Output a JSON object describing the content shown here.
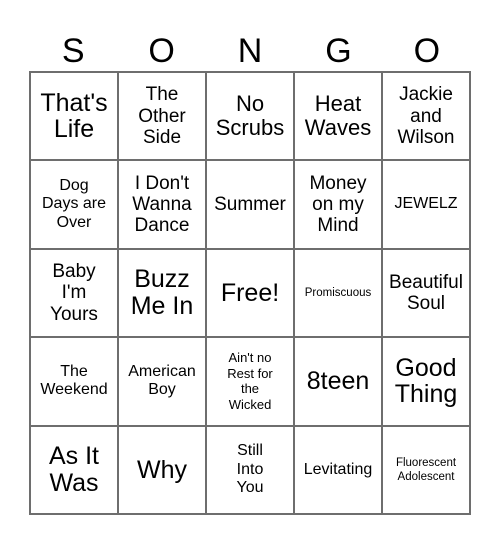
{
  "card": {
    "kind": "bingo-card",
    "header_letters": [
      "S",
      "O",
      "N",
      "G",
      "O"
    ],
    "grid_size": "5x5",
    "colors": {
      "background": "#ffffff",
      "text": "#000000",
      "grid_line": "#6e6e6e"
    },
    "rows": [
      [
        {
          "label": "That's\nLife",
          "size": "s-xl"
        },
        {
          "label": "The\nOther\nSide",
          "size": "s-md"
        },
        {
          "label": "No\nScrubs",
          "size": "s-lg"
        },
        {
          "label": "Heat\nWaves",
          "size": "s-lg"
        },
        {
          "label": "Jackie\nand\nWilson",
          "size": "s-md"
        }
      ],
      [
        {
          "label": "Dog\nDays are\nOver",
          "size": "s-sm"
        },
        {
          "label": "I Don't\nWanna\nDance",
          "size": "s-md"
        },
        {
          "label": "Summer",
          "size": "s-md"
        },
        {
          "label": "Money\non my\nMind",
          "size": "s-md"
        },
        {
          "label": "JEWELZ",
          "size": "s-sm"
        }
      ],
      [
        {
          "label": "Baby\nI'm\nYours",
          "size": "s-md"
        },
        {
          "label": "Buzz\nMe In",
          "size": "s-xl"
        },
        {
          "label": "Free!",
          "size": "s-xl"
        },
        {
          "label": "Promiscuous",
          "size": "s-xxs"
        },
        {
          "label": "Beautiful\nSoul",
          "size": "s-md"
        }
      ],
      [
        {
          "label": "The\nWeekend",
          "size": "s-sm"
        },
        {
          "label": "American\nBoy",
          "size": "s-sm"
        },
        {
          "label": "Ain't no\nRest for\nthe\nWicked",
          "size": "s-xs"
        },
        {
          "label": "8teen",
          "size": "s-xl"
        },
        {
          "label": "Good\nThing",
          "size": "s-xl"
        }
      ],
      [
        {
          "label": "As It\nWas",
          "size": "s-xl"
        },
        {
          "label": "Why",
          "size": "s-xl"
        },
        {
          "label": "Still\nInto\nYou",
          "size": "s-sm"
        },
        {
          "label": "Levitating",
          "size": "s-sm"
        },
        {
          "label": "Fluorescent\nAdolescent",
          "size": "s-xxs"
        }
      ]
    ]
  }
}
